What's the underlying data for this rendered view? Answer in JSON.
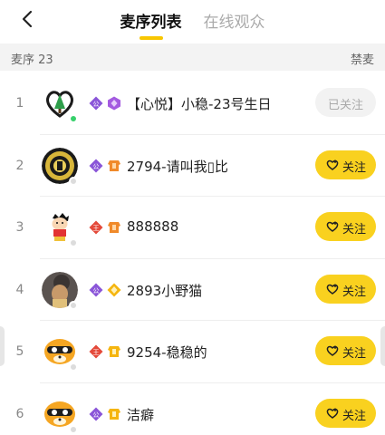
{
  "header": {
    "tabs": [
      {
        "label": "麦序列表",
        "active": true
      },
      {
        "label": "在线观众",
        "active": false
      }
    ]
  },
  "subheader": {
    "left": "麦序 23",
    "right": "禁麦"
  },
  "colors": {
    "accent": "#f9d11f",
    "online": "#37d06b",
    "divider": "#eeeeee"
  },
  "rows": [
    {
      "index": "1",
      "name": "【心悦】小稳-23号生日",
      "online": true,
      "badges": [
        "gong-icon",
        "rank-purple-icon"
      ],
      "follow_label": "已关注",
      "followed": true
    },
    {
      "index": "2",
      "name": "2794-请叫我▯比",
      "online": false,
      "badges": [
        "gong-icon",
        "rank-orange-icon"
      ],
      "follow_label": "关注",
      "followed": false
    },
    {
      "index": "3",
      "name": "888888",
      "online": false,
      "badges": [
        "wang-icon",
        "rank-orange-icon"
      ],
      "follow_label": "关注",
      "followed": false
    },
    {
      "index": "4",
      "name": "2893小野猫",
      "online": false,
      "badges": [
        "gong-icon",
        "rank-yellow-icon"
      ],
      "follow_label": "关注",
      "followed": false
    },
    {
      "index": "5",
      "name": "9254-稳稳的",
      "online": false,
      "badges": [
        "wang-icon",
        "rank-yellow-icon"
      ],
      "follow_label": "关注",
      "followed": false
    },
    {
      "index": "6",
      "name": "洁癖",
      "online": false,
      "badges": [
        "gong-icon",
        "rank-yellow-icon"
      ],
      "follow_label": "关注",
      "followed": false
    }
  ]
}
